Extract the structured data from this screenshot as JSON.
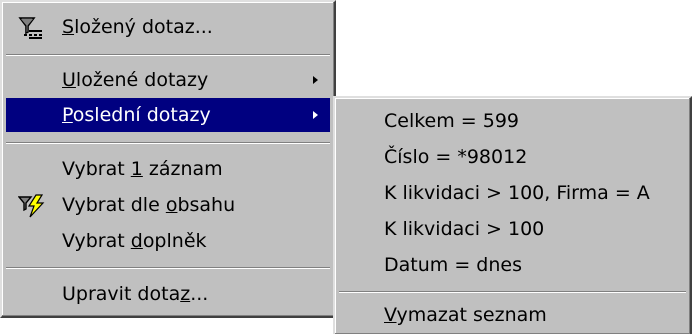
{
  "main_menu": {
    "items": [
      {
        "pre": "",
        "u": "S",
        "post": "ložený dotaz..."
      },
      {
        "pre": "",
        "u": "U",
        "post": "ložené dotazy"
      },
      {
        "pre": "",
        "u": "P",
        "post": "oslední dotazy"
      },
      {
        "pre": "Vybrat ",
        "u": "1",
        "post": " záznam"
      },
      {
        "pre": "Vybrat dle ",
        "u": "o",
        "post": "bsahu"
      },
      {
        "pre": "Vybrat ",
        "u": "d",
        "post": "oplněk"
      },
      {
        "pre": "Upravit dota",
        "u": "z",
        "post": "..."
      }
    ]
  },
  "sub_menu": {
    "items": [
      {
        "pre": "",
        "u": "",
        "post": "Celkem = 599"
      },
      {
        "pre": "",
        "u": "",
        "post": "Číslo = *98012"
      },
      {
        "pre": "",
        "u": "",
        "post": "K likvidaci > 100, Firma = A"
      },
      {
        "pre": "",
        "u": "",
        "post": "K likvidaci > 100"
      },
      {
        "pre": "",
        "u": "",
        "post": "Datum = dnes"
      },
      {
        "pre": "",
        "u": "V",
        "post": "ymazat seznam"
      }
    ]
  },
  "icons": {
    "compound_query": "funnel-with-list-icon",
    "select_by_content": "funnel-with-lightning-icon"
  },
  "colors": {
    "menu_bg": "#c0c0c0",
    "highlight_bg": "#000080",
    "highlight_text": "#ffffff"
  }
}
